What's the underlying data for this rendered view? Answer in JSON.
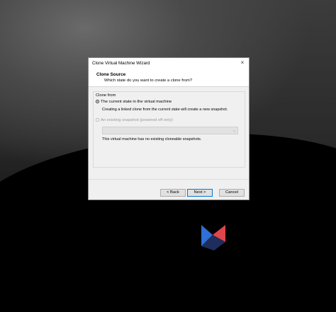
{
  "window": {
    "title": "Clone Virtual Machine Wizard",
    "close_glyph": "×"
  },
  "header": {
    "title": "Clone Source",
    "subtitle": "Which state do you want to create a clone from?"
  },
  "group": {
    "label": "Clone from",
    "option_current": {
      "label": "The current state in the virtual machine",
      "description": "Creating a linked clone from the current state will create a new snapshot.",
      "selected": true
    },
    "option_snapshot": {
      "label": "An existing snapshot (powered off only):",
      "description": "This virtual machine has no existing cloneable snapshots.",
      "enabled": false,
      "dropdown_value": ""
    }
  },
  "buttons": {
    "back": "< Back",
    "next": "Next >",
    "cancel": "Cancel"
  },
  "colors": {
    "focus_border": "#0078d7",
    "logo_blue": "#2f6fd6",
    "logo_red": "#e0454b",
    "logo_navy": "#1f2d5c"
  }
}
